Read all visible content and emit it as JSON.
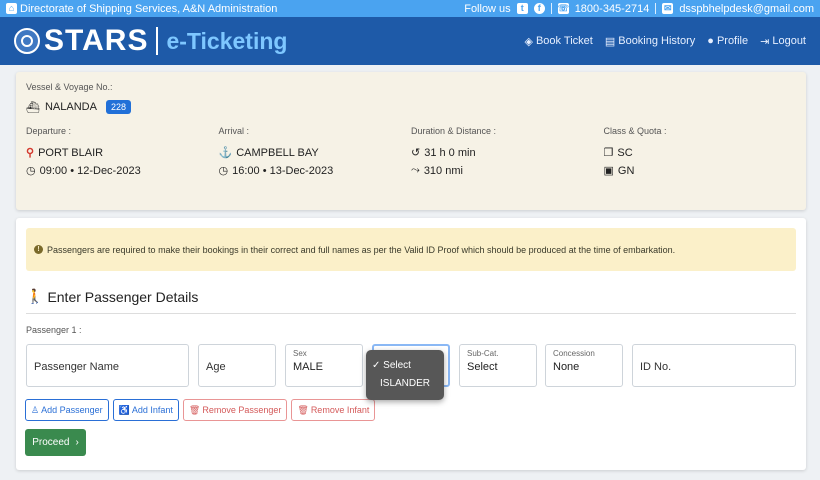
{
  "topbar": {
    "org": "Directorate of Shipping Services, A&N Administration",
    "follow": "Follow us",
    "phone": "1800-345-2714",
    "email": "dsspbhelpdesk@gmail.com"
  },
  "navbar": {
    "brand": "STARS",
    "subtitle": "e-Ticketing",
    "links": [
      "Book Ticket",
      "Booking History",
      "Profile",
      "Logout"
    ]
  },
  "voyage": {
    "vessel_label": "Vessel & Voyage No.:",
    "vessel_name": "NALANDA",
    "voyage_no": "228",
    "departure_label": "Departure :",
    "departure_port": "PORT BLAIR",
    "departure_time": "09:00 • 12-Dec-2023",
    "arrival_label": "Arrival :",
    "arrival_port": "CAMPBELL BAY",
    "arrival_time": "16:00 • 13-Dec-2023",
    "duration_label": "Duration & Distance :",
    "duration": "31 h 0 min",
    "distance": "310 nmi",
    "class_label": "Class & Quota :",
    "class": "SC",
    "quota": "GN"
  },
  "passenger": {
    "alert": "Passengers are required to make their bookings in their correct and full names as per the Valid ID Proof which should be produced at the time of embarkation.",
    "section_title": "Enter Passenger Details",
    "passenger_label": "Passenger 1 :",
    "fields": {
      "name_placeholder": "Passenger Name",
      "age_placeholder": "Age",
      "sex_label": "Sex",
      "sex_value": "MALE",
      "subcat_label": "Sub-Cat.",
      "subcat_value": "Select",
      "concession_label": "Concession",
      "concession_value": "None",
      "id_placeholder": "ID No."
    },
    "category_options": [
      "✓ Select",
      "ISLANDER"
    ],
    "buttons": {
      "add_passenger": "Add Passenger",
      "add_infant": "Add Infant",
      "remove_passenger": "Remove Passenger",
      "remove_infant": "Remove Infant",
      "proceed": "Proceed"
    }
  },
  "colors": {
    "topbar": "#4aa3f0",
    "navbar": "#1e5aa8",
    "accent_blue": "#2a6fd6",
    "proceed_green": "#3a8a4e",
    "alert_bg": "#fbf0c9"
  }
}
